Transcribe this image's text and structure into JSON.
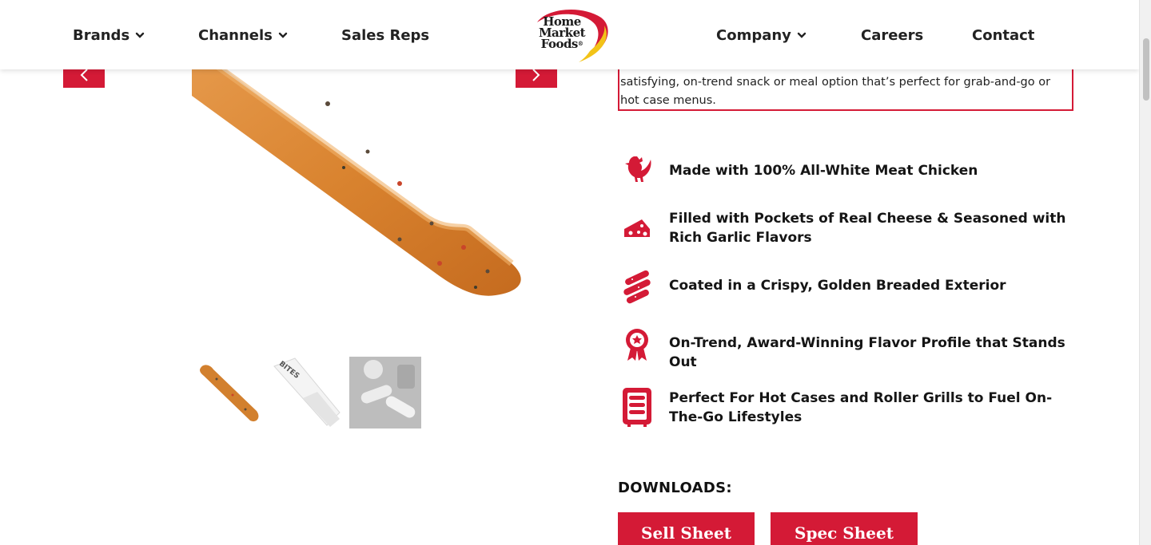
{
  "nav": {
    "brands": "Brands",
    "channels": "Channels",
    "sales_reps": "Sales Reps",
    "company": "Company",
    "careers": "Careers",
    "contact": "Contact"
  },
  "logo": {
    "line1": "Home",
    "line2": "Market",
    "line3": "Foods",
    "mark": "®"
  },
  "product": {
    "description_partial": "satisfying, on-trend snack or meal option that’s perfect for grab-and-go or hot case menus."
  },
  "features": [
    {
      "icon": "chicken-icon",
      "text": "Made with 100% All-White Meat Chicken"
    },
    {
      "icon": "cheese-icon",
      "text": "Filled with Pockets of Real Cheese & Seasoned with Rich Garlic Flavors"
    },
    {
      "icon": "breadsticks-icon",
      "text": "Coated in a Crispy, Golden Breaded Exterior"
    },
    {
      "icon": "award-ribbon-icon",
      "text": "On-Trend, Award-Winning Flavor Profile that Stands Out"
    },
    {
      "icon": "hot-case-icon",
      "text": "Perfect For Hot Cases and Roller Grills to Fuel On-The-Go Lifestyles"
    }
  ],
  "thumbnail_pack_text": "BITES",
  "downloads": {
    "title": "DOWNLOADS:",
    "sell_sheet": "Sell Sheet",
    "spec_sheet": "Spec Sheet"
  },
  "colors": {
    "brand_red": "#d41a36",
    "logo_yellow": "#f2c318"
  }
}
